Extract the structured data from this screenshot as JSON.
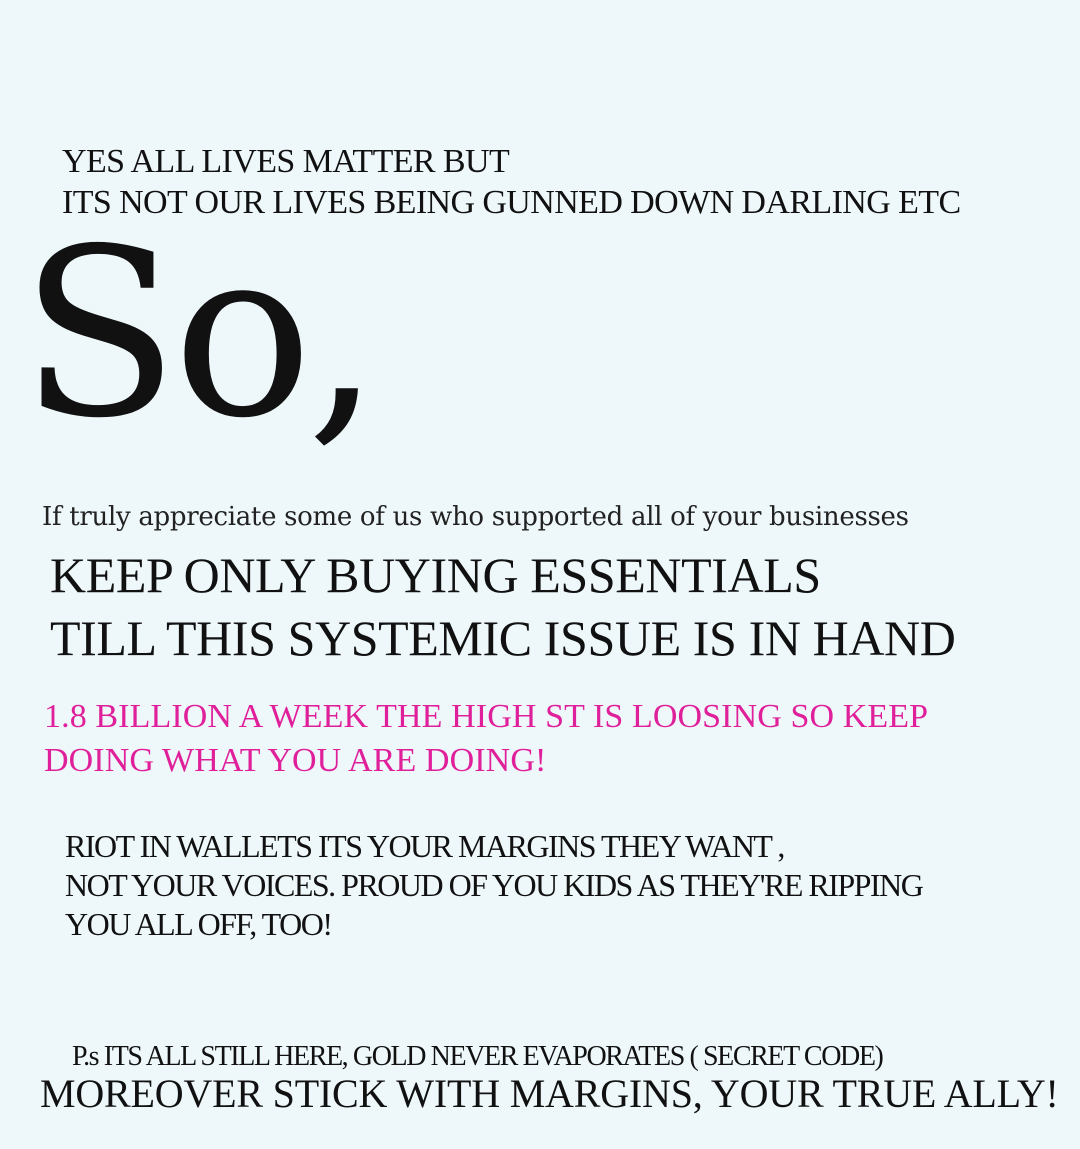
{
  "intro": {
    "line1": "YES ALL LIVES MATTER BUT",
    "line2": "ITS NOT OUR LIVES BEING GUNNED DOWN DARLING ETC"
  },
  "headline": "So,",
  "appreciate": "If truly appreciate some of us who supported all of your businesses",
  "keep": {
    "line1": "KEEP ONLY BUYING ESSENTIALS",
    "line2": "TILL THIS SYSTEMIC ISSUE IS IN HAND"
  },
  "highlight": {
    "color": "#e0209a",
    "line1": "1.8 BILLION A WEEK THE HIGH ST IS LOOSING SO KEEP",
    "line2": "DOING WHAT YOU ARE DOING!"
  },
  "riot": {
    "line1": "RIOT IN WALLETS ITS YOUR MARGINS THEY WANT ,",
    "line2": "NOT YOUR VOICES. PROUD OF YOU KIDS AS THEY'RE RIPPING",
    "line3": "YOU ALL OFF,  TOO!"
  },
  "footer": {
    "ps": "P.s ITS ALL STILL HERE, GOLD NEVER EVAPORATES ( SECRET CODE)",
    "closing": "MOREOVER STICK WITH MARGINS,  YOUR TRUE ALLY!"
  }
}
